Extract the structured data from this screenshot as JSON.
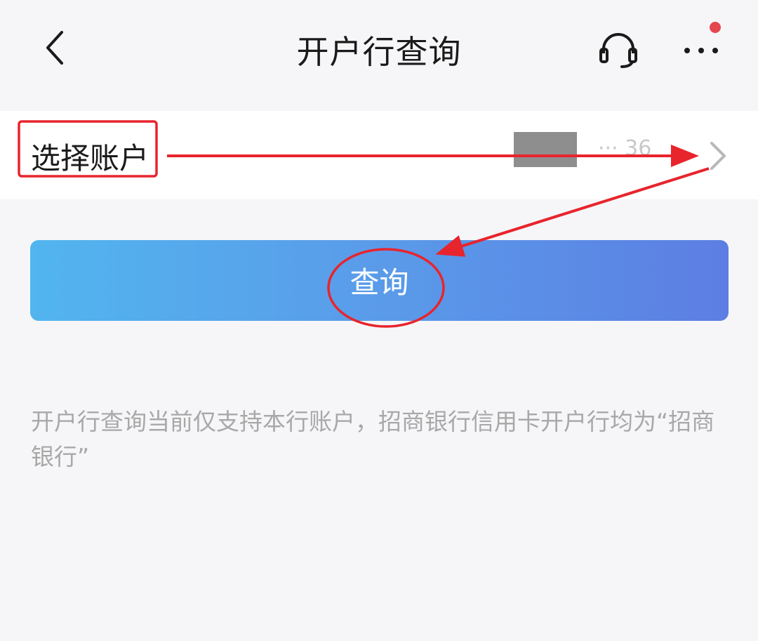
{
  "header": {
    "title": "开户行查询",
    "back_icon": "chevron-left-icon",
    "support_icon": "headset-icon",
    "more_icon": "more-dots-icon",
    "has_notification": true
  },
  "account_row": {
    "label": "选择账户",
    "value": "··· 36",
    "chevron_icon": "chevron-right-icon"
  },
  "query_button": {
    "label": "查询"
  },
  "note": {
    "text": "开户行查询当前仅支持本行账户，招商银行信用卡开户行均为“招商银行”"
  },
  "colors": {
    "background": "#f6f6f8",
    "button_gradient_start": "#52b5ef",
    "button_gradient_end": "#5c7ee3",
    "annotation_red": "#e8242d",
    "notification_dot": "#e5474e"
  }
}
